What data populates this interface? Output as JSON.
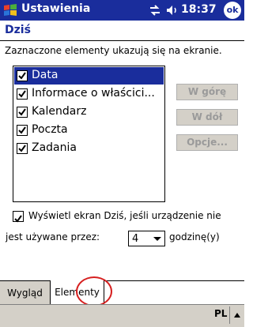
{
  "titlebar": {
    "title": "Ustawienia",
    "time": "18:37",
    "ok_label": "ok",
    "icons": [
      "windows-logo",
      "connectivity-icon",
      "volume-icon"
    ]
  },
  "page": {
    "title": "Dziś",
    "instruction": "Zaznaczone elementy ukazują się na ekranie."
  },
  "items": [
    {
      "label": "Data",
      "checked": true,
      "selected": true
    },
    {
      "label": "Informace o właścici...",
      "checked": true,
      "selected": false
    },
    {
      "label": "Kalendarz",
      "checked": true,
      "selected": false
    },
    {
      "label": "Poczta",
      "checked": true,
      "selected": false
    },
    {
      "label": "Zadania",
      "checked": true,
      "selected": false
    }
  ],
  "buttons": {
    "up": "W górę",
    "down": "W dół",
    "options": "Opcje..."
  },
  "show_today": {
    "checked": true,
    "label": "Wyświetl ekran Dziś, jeśli urządzenie nie",
    "label2": "jest używane przez:",
    "hours": "4",
    "suffix": "godzinę(y)"
  },
  "tabs": [
    {
      "label": "Wygląd",
      "active": false
    },
    {
      "label": "Elementy",
      "active": true
    }
  ],
  "taskbar": {
    "input_lang": "PL"
  },
  "colors": {
    "titlebar": "#1a2d9c",
    "selection": "#1a2d9c",
    "highlight_circle": "#d62020"
  }
}
